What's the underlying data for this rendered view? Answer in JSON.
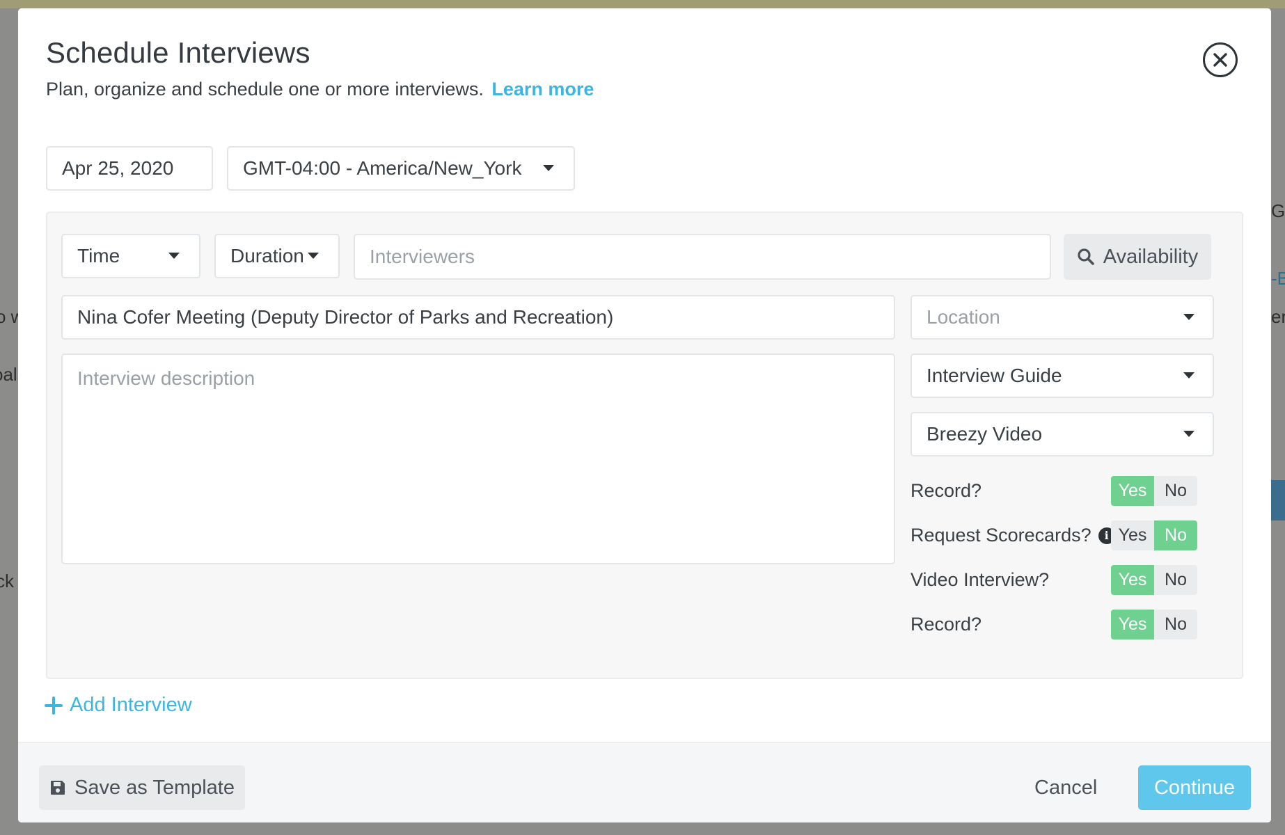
{
  "background": {
    "fragments_left": [
      "o w",
      "oals",
      "ck A"
    ],
    "fragments_right": [
      "GM",
      "-B",
      "ert"
    ]
  },
  "modal": {
    "title": "Schedule Interviews",
    "subtitle": "Plan, organize and schedule one or more interviews.",
    "learn_more": "Learn more",
    "close_icon": "close-circle-icon"
  },
  "date": {
    "value": "Apr 25, 2020"
  },
  "timezone": {
    "value": "GMT-04:00 - America/New_York"
  },
  "interview": {
    "time_label": "Time",
    "duration_label": "Duration",
    "interviewers_placeholder": "Interviewers",
    "availability_label": "Availability",
    "title_value": "Nina Cofer Meeting (Deputy Director of Parks and Recreation)",
    "location_placeholder": "Location",
    "description_placeholder": "Interview description",
    "guide_label": "Interview Guide",
    "video_label": "Breezy Video",
    "toggles": [
      {
        "label": "Record?",
        "yes": "Yes",
        "no": "No",
        "selected": "Yes"
      },
      {
        "label": "Request Scorecards?",
        "yes": "Yes",
        "no": "No",
        "selected": "No",
        "info_icon": "info-icon"
      },
      {
        "label": "Video Interview?",
        "yes": "Yes",
        "no": "No",
        "selected": "Yes"
      },
      {
        "label": "Record?",
        "yes": "Yes",
        "no": "No",
        "selected": "Yes"
      }
    ]
  },
  "add_interview": "Add Interview",
  "footer": {
    "save_template": "Save as Template",
    "cancel": "Cancel",
    "continue": "Continue"
  },
  "colors": {
    "accent": "#3cb6e0",
    "toggle_on": "#6fd18f",
    "continue_bg": "#5fc6ec"
  }
}
